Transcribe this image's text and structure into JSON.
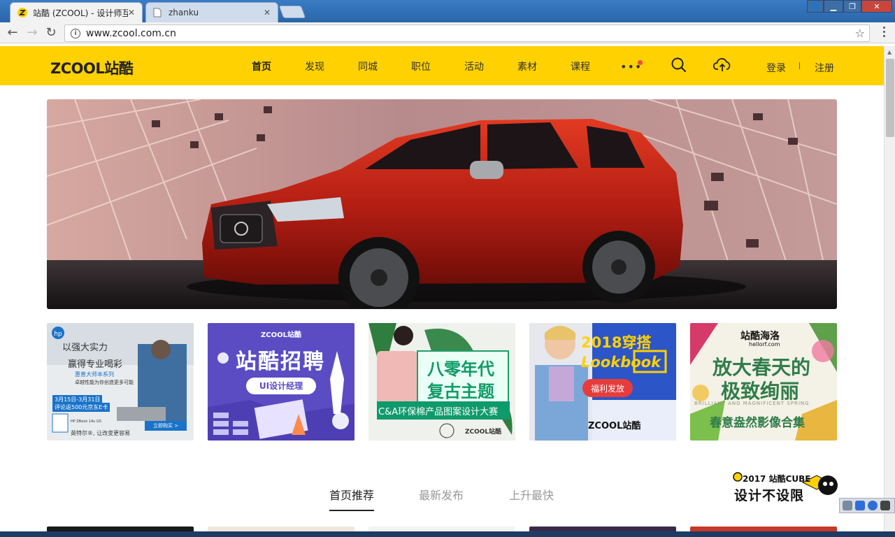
{
  "browser": {
    "tabs": [
      {
        "title": "站酷 (ZCOOL) - 设计师互",
        "active": true
      },
      {
        "title": "zhanku",
        "active": false
      }
    ],
    "address": "www.zcool.com.cn"
  },
  "header": {
    "logo": "ZCOOL站酷",
    "nav": [
      "首页",
      "发现",
      "同城",
      "职位",
      "活动",
      "素材",
      "课程"
    ],
    "more": "•••",
    "login": "登录",
    "register": "注册"
  },
  "promos": [
    {
      "lines": [
        "以强大实力",
        "赢得专业喝彩",
        "惠普大师本系列",
        "卓越性能为你创造更多可能",
        "3月15日-3月31日",
        "评论返500元京东E卡",
        "立即购买 >",
        "HP ZBook 14u G5",
        "英特尔®, 让改变更容易"
      ]
    },
    {
      "lines": [
        "ZCOOL站酷",
        "站酷招聘",
        "UI设计经理"
      ]
    },
    {
      "lines": [
        "八零年代",
        "复古主题",
        "C&A环保棉产品图案设计大赛",
        "ZCOOL站酷"
      ]
    },
    {
      "lines": [
        "2018穿搭",
        "Lookbook",
        "福利发放",
        "ZCOOL站酷"
      ]
    },
    {
      "lines": [
        "站酷海洛",
        "hellorf.com",
        "放大春天的",
        "极致绚丽",
        "BRILLIANT AND MAGNIFICENT SPRING",
        "春意盎然影像合集"
      ]
    }
  ],
  "feed_tabs": [
    "首页推荐",
    "最新发布",
    "上升最快"
  ],
  "cube": {
    "line1": "2017 站酷CUBE",
    "line2": "设计不设限"
  },
  "colors": {
    "brand_yellow": "#ffd100",
    "red_dot": "#f54b3c"
  }
}
